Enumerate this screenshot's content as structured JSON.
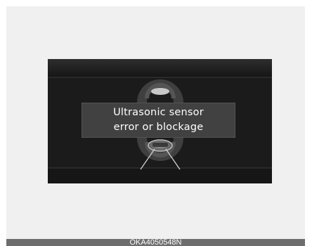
{
  "display": {
    "message_line1": "Ultrasonic sensor",
    "message_line2": "error or blockage"
  },
  "caption": {
    "code": "OKA4050548N"
  }
}
